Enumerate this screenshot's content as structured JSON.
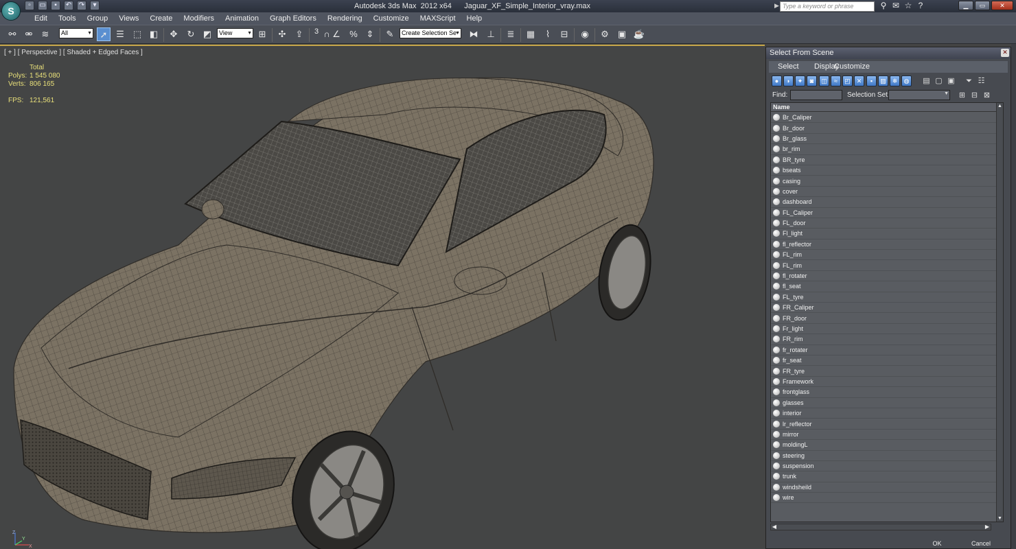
{
  "app": {
    "logo_letter": "S",
    "window_title": "Autodesk 3ds Max  2012 x64      Jaguar_XF_Simple_Interior_vray.max",
    "search_placeholder": "Type a keyword or phrase",
    "quick_access_icons": [
      "new-icon",
      "open-icon",
      "save-icon",
      "undo-icon",
      "redo-icon",
      "project-folder-icon"
    ],
    "info_center_icons": [
      "binoculars-icon",
      "communication-center-icon",
      "favorites-star-icon",
      "help-icon"
    ]
  },
  "menu": [
    "Edit",
    "Tools",
    "Group",
    "Views",
    "Create",
    "Modifiers",
    "Animation",
    "Graph Editors",
    "Rendering",
    "Customize",
    "MAXScript",
    "Help"
  ],
  "toolbar": {
    "selection_filter": "All",
    "reference_coord": "View",
    "named_selection": "Create Selection Se",
    "snap_label": "3"
  },
  "viewport": {
    "label": "[ + ] [ Perspective ] [ Shaded + Edged Faces ]",
    "stats": {
      "total_label": "Total",
      "polys_label": "Polys:",
      "polys_value": "1 545 080",
      "verts_label": "Verts:",
      "verts_value": "806 165",
      "fps_label": "FPS:",
      "fps_value": "121,561"
    },
    "gizmo": {
      "x": "X",
      "y": "Y",
      "z": "Z"
    },
    "model_color": "#7b7263",
    "wire_color": "#3a3630"
  },
  "dialog": {
    "title": "Select From Scene",
    "menu": [
      "Select",
      "Display",
      "Customize"
    ],
    "find_label": "Find:",
    "selection_set_label": "Selection Set:",
    "column_header": "Name",
    "objects": [
      "Br_Caliper",
      "Br_door",
      "Br_glass",
      "br_rim",
      "BR_tyre",
      "bseats",
      "casing",
      "cover",
      "dashboard",
      "FL_Caliper",
      "FL_door",
      "Fl_light",
      "fl_reflector",
      "FL_rim",
      "FL_rim",
      "fl_rotater",
      "fl_seat",
      "FL_tyre",
      "FR_Caliper",
      "FR_door",
      "Fr_light",
      "FR_rim",
      "fr_rotater",
      "fr_seat",
      "FR_tyre",
      "Framework",
      "frontglass",
      "glasses",
      "interior",
      "lr_reflector",
      "mirror",
      "moldingL",
      "steering",
      "suspension",
      "trunk",
      "windsheild",
      "wire"
    ],
    "ok_label": "OK",
    "cancel_label": "Cancel"
  }
}
